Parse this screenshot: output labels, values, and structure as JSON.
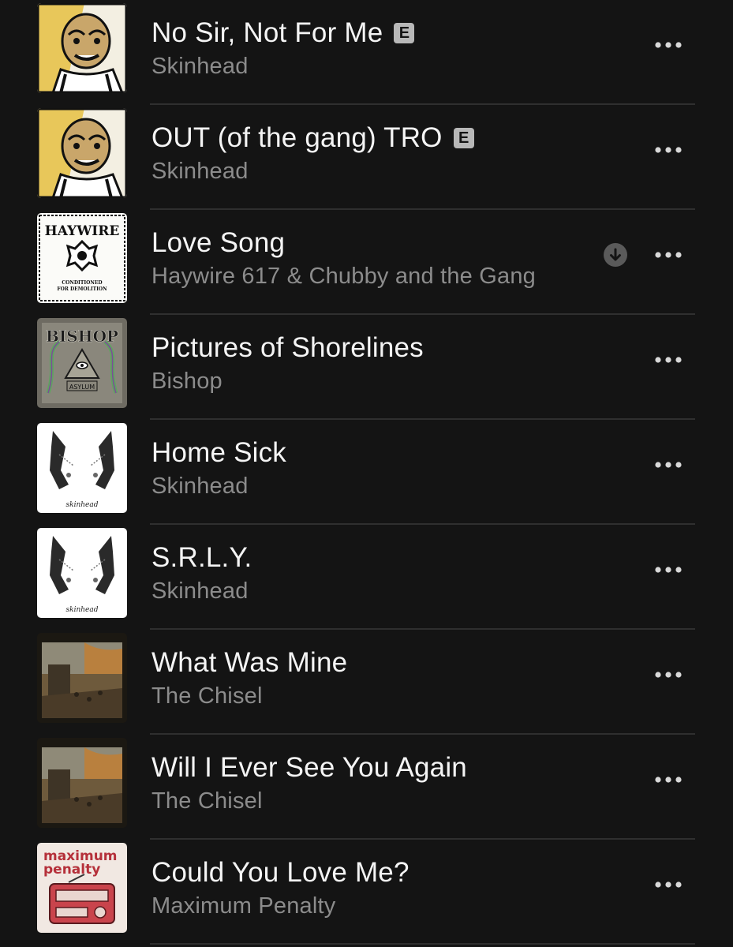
{
  "tracks": [
    {
      "title": "No Sir, Not For Me",
      "artist": "Skinhead",
      "explicit": true,
      "explicit_label": "E",
      "downloaded": false,
      "artwork": "cartoon-face-art"
    },
    {
      "title": "OUT (of the gang) TRO",
      "artist": "Skinhead",
      "explicit": true,
      "explicit_label": "E",
      "downloaded": false,
      "artwork": "cartoon-face-art"
    },
    {
      "title": "Love Song",
      "artist": "Haywire 617 & Chubby and the Gang",
      "explicit": false,
      "downloaded": true,
      "artwork": "haywire-art",
      "art_text": "HAYWIRE",
      "art_subtext": "CONDITIONED FOR DEMOLITION"
    },
    {
      "title": "Pictures of Shorelines",
      "artist": "Bishop",
      "explicit": false,
      "downloaded": false,
      "artwork": "bishop-art",
      "art_text": "BISHOP",
      "art_subtext": "ASYLUM"
    },
    {
      "title": "Home Sick",
      "artist": "Skinhead",
      "explicit": false,
      "downloaded": false,
      "artwork": "hands-art",
      "art_text": "skinhead"
    },
    {
      "title": "S.R.L.Y.",
      "artist": "Skinhead",
      "explicit": false,
      "downloaded": false,
      "artwork": "hands-art",
      "art_text": "skinhead"
    },
    {
      "title": "What Was Mine",
      "artist": "The Chisel",
      "explicit": false,
      "downloaded": false,
      "artwork": "painting-art"
    },
    {
      "title": "Will I Ever See You Again",
      "artist": "The Chisel",
      "explicit": false,
      "downloaded": false,
      "artwork": "painting-art"
    },
    {
      "title": "Could You Love Me?",
      "artist": "Maximum Penalty",
      "explicit": false,
      "downloaded": false,
      "artwork": "radio-art",
      "art_text": "maximum",
      "art_subtext": "penalty"
    }
  ],
  "icons": {
    "more": "ellipsis-icon",
    "download": "download-icon"
  },
  "colors": {
    "background": "#141414",
    "title": "#f4f4f4",
    "artist": "#8c8c8c",
    "divider": "#2f2f2f",
    "explicit_badge": "#b8b8b8"
  }
}
